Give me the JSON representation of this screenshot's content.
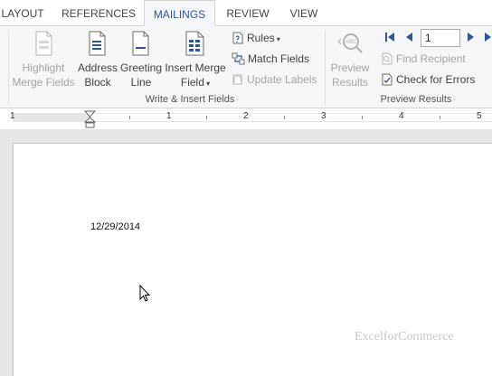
{
  "tabs": [
    {
      "label": "LAYOUT",
      "active": false
    },
    {
      "label": "REFERENCES",
      "active": false
    },
    {
      "label": "MAILINGS",
      "active": true
    },
    {
      "label": "REVIEW",
      "active": false
    },
    {
      "label": "VIEW",
      "active": false
    }
  ],
  "ribbon": {
    "write_insert": {
      "highlight": {
        "line1": "Highlight",
        "line2": "Merge Fields"
      },
      "address": {
        "line1": "Address",
        "line2": "Block"
      },
      "greeting": {
        "line1": "Greeting",
        "line2": "Line"
      },
      "insert_merge": {
        "line1": "Insert Merge",
        "line2": "Field"
      },
      "rules": "Rules",
      "match_fields": "Match Fields",
      "update_labels": "Update Labels",
      "group_label": "Write & Insert Fields"
    },
    "preview": {
      "preview_results": {
        "line1": "Preview",
        "line2": "Results"
      },
      "record_value": "1",
      "find_recipient": "Find Recipient",
      "check_errors": "Check for Errors",
      "group_label": "Preview Results"
    }
  },
  "ruler": {
    "numbers": [
      "1",
      "1",
      "2",
      "3",
      "4",
      "5"
    ]
  },
  "document": {
    "date_text": "12/29/2014",
    "watermark": "ExcelforCommerce"
  },
  "colors": {
    "accent": "#2b579a",
    "ribbon_bg": "#f5f6f7",
    "disabled": "#a6a6a6"
  }
}
